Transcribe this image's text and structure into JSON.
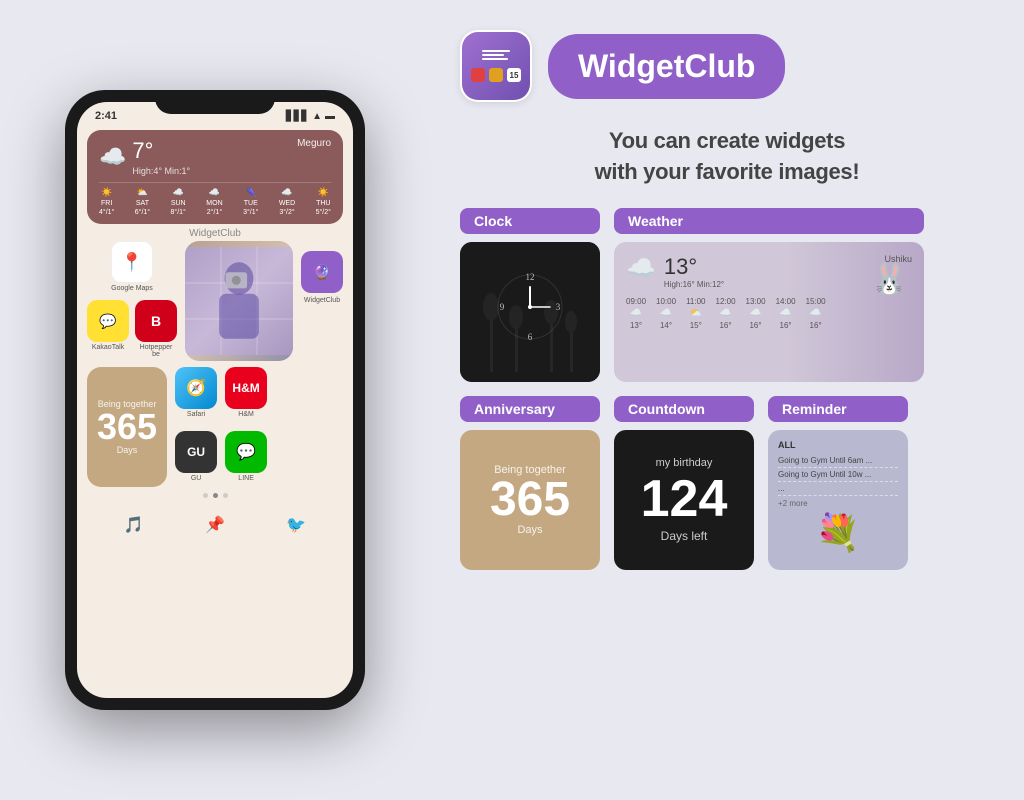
{
  "app": {
    "name": "WidgetClub",
    "tagline_line1": "You can create widgets",
    "tagline_line2": "with your favorite images!"
  },
  "phone": {
    "status_time": "2:41",
    "weather_widget": {
      "temp": "7°",
      "location": "Meguro",
      "high": "High:4°",
      "min": "Min:1°",
      "days": [
        "FRI",
        "SAT",
        "SUN",
        "MON",
        "TUE",
        "WED",
        "THU"
      ],
      "day_temps": [
        "4°/1°",
        "6°/1°",
        "8°/1°",
        "2°/1°",
        "3°/1°",
        "3°/2°",
        "5°/2°"
      ]
    },
    "widget_club_label": "WidgetClub",
    "apps": [
      {
        "label": "Google Maps",
        "emoji": "📍"
      },
      {
        "label": "KakaoTalk",
        "emoji": "💬"
      },
      {
        "label": "Hotpepper be",
        "emoji": "🌶"
      },
      {
        "label": "WidgetClub",
        "emoji": "🔮"
      }
    ],
    "anniversary_widget": {
      "being_together": "Being together",
      "number": "365",
      "days": "Days"
    },
    "small_apps": [
      {
        "label": "Safari",
        "emoji": "🧭"
      },
      {
        "label": "H&M",
        "emoji": "🛍"
      },
      {
        "label": "GU",
        "emoji": "👗"
      },
      {
        "label": "LINE",
        "emoji": "💬"
      }
    ]
  },
  "categories": {
    "clock": {
      "label": "Clock",
      "clock_number_12": "12",
      "clock_number_3": "3",
      "clock_number_6": "6",
      "clock_number_9": "9"
    },
    "weather": {
      "label": "Weather",
      "temp": "13°",
      "location": "Ushiku",
      "high": "High:16°",
      "min": "Min:12°",
      "times": [
        "09:00",
        "10:00",
        "11:00",
        "12:00",
        "13:00",
        "14:00",
        "15:00"
      ],
      "temps": [
        "13°",
        "14°",
        "15°",
        "16°",
        "16°",
        "16°",
        "16°"
      ]
    },
    "anniversary": {
      "label": "Anniversary",
      "being_together": "Being together",
      "number": "365",
      "days": "Days"
    },
    "countdown": {
      "label": "Countdown",
      "title": "my birthday",
      "number": "124",
      "days_left": "Days left"
    },
    "reminder": {
      "label": "Reminder",
      "all": "ALL",
      "items": [
        "Going to Gym Until 6am ...",
        "Going to Gym Until 10w ...",
        "..."
      ],
      "more": "+2 more"
    }
  }
}
